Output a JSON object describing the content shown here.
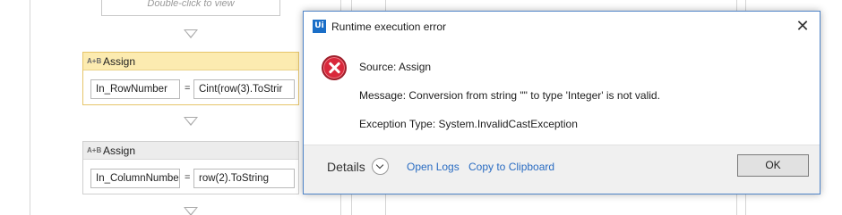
{
  "designer": {
    "sequence_hint": "Double-click to view",
    "activities": [
      {
        "title": "Assign",
        "icon": "assign-icon",
        "icon_text": "A+B",
        "to": "In_RowNumber",
        "eq": "=",
        "value": "Cint(row(3).ToStrir"
      },
      {
        "title": "Assign",
        "icon": "assign-icon",
        "icon_text": "A+B",
        "to": "In_ColumnNumbe",
        "eq": "=",
        "value": "row(2).ToString"
      }
    ]
  },
  "dialog": {
    "title": "Runtime execution error",
    "app_logo": "Ui",
    "close_glyph": "✕",
    "source": "Source: Assign",
    "message": "Message: Conversion from string \"\" to type 'Integer' is not valid.",
    "exception": "Exception Type: System.InvalidCastException",
    "details_label": "Details",
    "open_logs": "Open Logs",
    "copy_clipboard": "Copy to Clipboard",
    "ok_label": "OK",
    "icons": {
      "error": "error-icon",
      "close": "close-icon",
      "logo": "uipath-logo-icon",
      "chevron": "chevron-down-icon"
    },
    "colors": {
      "accent": "#4f84c8",
      "link": "#2a6cc2",
      "error": "#d9283b"
    }
  }
}
